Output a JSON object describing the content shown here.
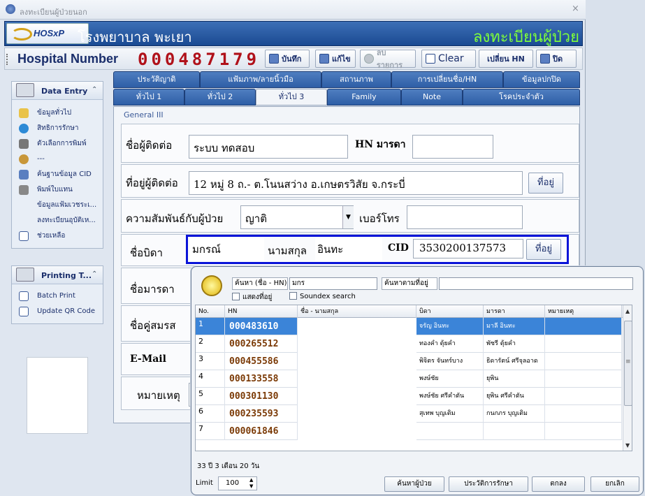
{
  "window": {
    "title": "ลงทะเบียนผู้ป่วยนอก",
    "close": "×"
  },
  "banner": {
    "logo_text": "HOSxP",
    "hospital_name": "โรงพยาบาล พะเยา",
    "screen_title": "ลงทะเบียนผู้ป่วย"
  },
  "toolbar": {
    "hn_label": "Hospital Number",
    "hn_value": "000487179",
    "save": "บันทึก",
    "edit": "แก้ไข",
    "delete": "ลบรายการ",
    "clear": "Clear",
    "change_hn": "เปลี่ยน HN",
    "close": "ปิด"
  },
  "sidebar": {
    "section1_title": "Data Entry",
    "items": [
      "ข้อมูลทั่วไป",
      "สิทธิการรักษา",
      "ตัวเลือกการพิมพ์",
      "---",
      "ค้นฐานข้อมูล CID",
      "พิมพ์ใบแทน",
      "ข้อมูลแฟ้มเวชระเ...",
      "ลงทะเบียนอุบัติเห...",
      "ช่วยเหลือ"
    ],
    "section2_title": "Printing T...",
    "items2": [
      "Batch Print",
      "Update QR Code"
    ]
  },
  "tabs_row1": [
    "ประวัติญาติ",
    "แฟ้มภาพ/ลายนิ้วมือ",
    "สถานภาพ",
    "การเปลี่ยนชื่อ/HN",
    "ข้อมูลปกปิด"
  ],
  "tabs_row2": [
    "ทั่วไป 1",
    "ทั่วไป 2",
    "ทั่วไป 3",
    "Family",
    "Note",
    "โรคประจำตัว"
  ],
  "pane": {
    "group_label": "General III",
    "contact_label": "ชื่อผู้ติดต่อ",
    "contact_value": "ระบบ  ทดสอบ",
    "mother_hn_label": "HN มารดา",
    "mother_hn_value": "",
    "contact_addr_label": "ที่อยู่ผู้ติดต่อ",
    "contact_addr_value": "12 หมู่ 8 ถ.- ต.โนนสว่าง อ.เกษตรวิสัย จ.กระบี่",
    "addr_button": "ที่อยู่",
    "relation_label": "ความสัมพันธ์กับผู้ป่วย",
    "relation_value": "ญาติ",
    "phone_label": "เบอร์โทร",
    "phone_value": "",
    "father_label": "ชื่อบิดา",
    "father_first": "มกรณ์",
    "surname_label": "นามสกุล",
    "father_last": "อินทะ",
    "cid_label": "CID",
    "cid_value": "3530200137573",
    "mother_label": "ชื่อมารดา",
    "spouse_label": "ชื่อคู่สมรส",
    "email_label": "E-Mail",
    "note_label": "หมายเหตุ"
  },
  "popup": {
    "search_label": "ค้นหา (ชื่อ - HN)",
    "search_value": "มกร",
    "addr_search_label": "ค้นหาตามที่อยู่",
    "addr_search_value": "",
    "show_addr": "แสดงที่อยู่",
    "soundex": "Soundex search",
    "columns": [
      "No.",
      "HN",
      "ชื่อ - นามสกุล",
      "บิดา",
      "มารดา",
      "หมายเหตุ"
    ],
    "rows": [
      {
        "no": "1",
        "hn": "000483610",
        "name": "",
        "father": "จรัญ อินทะ",
        "mother": "มาลี อินทะ",
        "note": ""
      },
      {
        "no": "2",
        "hn": "000265512",
        "name": "",
        "father": "ทองคำ ตุ้ยคำ",
        "mother": "พัชรี ตุ้ยคำ",
        "note": ""
      },
      {
        "no": "3",
        "hn": "000455586",
        "name": "",
        "father": "พิจิตร จันทร์บาง",
        "mother": "ธิดารัตน์ ศรีจุลอาด",
        "note": ""
      },
      {
        "no": "4",
        "hn": "000133558",
        "name": "",
        "father": "พงษ์ชัย",
        "mother": "ยุพิน",
        "note": ""
      },
      {
        "no": "5",
        "hn": "000301130",
        "name": "",
        "father": "พงษ์ชัย ศรีคำตัน",
        "mother": "ยุพิน ศรีคำตัน",
        "note": ""
      },
      {
        "no": "6",
        "hn": "000235593",
        "name": "",
        "father": "สุเทพ บุญเติม",
        "mother": "กนกภร บุญเติม",
        "note": ""
      },
      {
        "no": "7",
        "hn": "000061846",
        "name": "",
        "father": "",
        "mother": "",
        "note": ""
      }
    ],
    "age_text": "33 ปี 3 เดือน 20 วัน",
    "limit_label": "Limit",
    "limit_value": "100",
    "btn_search": "ค้นหาผู้ป่วย",
    "btn_history": "ประวัติการรักษา",
    "btn_ok": "ตกลง",
    "btn_cancel": "ยกเลิก"
  }
}
